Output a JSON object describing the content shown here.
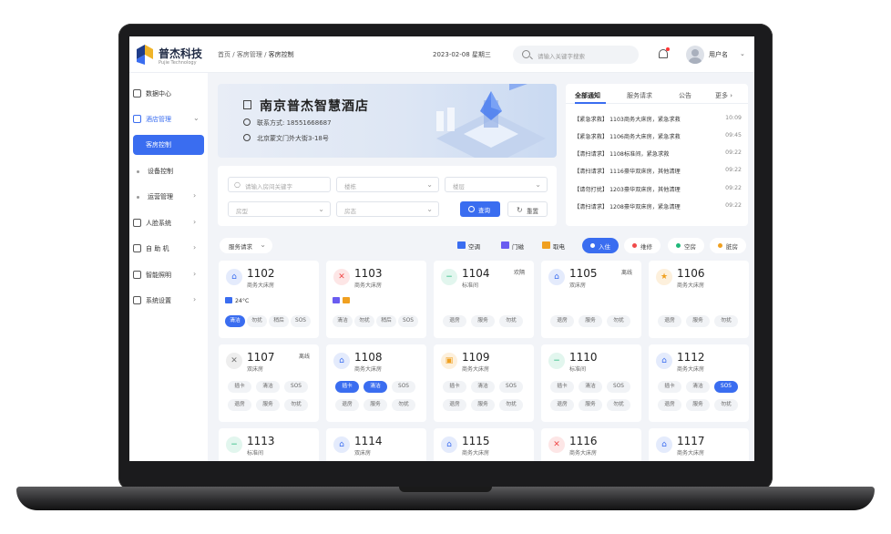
{
  "header": {
    "brand": "普杰科技",
    "brand_sub": "Pujie Technology",
    "breadcrumb": [
      "首页",
      "客房管理",
      "客房控制"
    ],
    "date": "2023-02-08 星期三",
    "search_placeholder": "请输入关键字搜索",
    "user_name": "用户名"
  },
  "sidebar": {
    "items": [
      {
        "label": "数据中心",
        "chevron": ""
      },
      {
        "label": "酒店管理",
        "chevron": "⌄"
      },
      {
        "label": "客房控制",
        "chevron": ""
      },
      {
        "label": "设备控制",
        "chevron": ""
      },
      {
        "label": "运营管理",
        "chevron": "›"
      },
      {
        "label": "人脸系统",
        "chevron": "›"
      },
      {
        "label": "自 助 机",
        "chevron": "›"
      },
      {
        "label": "智能照明",
        "chevron": "›"
      },
      {
        "label": "系统设置",
        "chevron": "›"
      }
    ]
  },
  "banner": {
    "hotel_name": "南京普杰智慧酒店",
    "contact": "联系方式: 18551668687",
    "address": "北京蒙文门外大街3-18号"
  },
  "notices": {
    "tabs": [
      "全部通知",
      "服务请求",
      "公告",
      "更多 ›"
    ],
    "items": [
      {
        "text": "【紧急求救】 1103商务大床房，紧急求救",
        "time": "10:09"
      },
      {
        "text": "【紧急求救】 1106商务大床房，紧急求救",
        "time": "09:45"
      },
      {
        "text": "【清扫请求】 1108标准间，紧急求救",
        "time": "09:22"
      },
      {
        "text": "【清扫请求】 1116豪华双床房，其他清理",
        "time": "09:22"
      },
      {
        "text": "【请勿打扰】 1203豪华双床房，其他清理",
        "time": "09:22"
      },
      {
        "text": "【清扫请求】 1208豪华双床房，紧急清理",
        "time": "09:22"
      }
    ]
  },
  "filters": {
    "keyword_placeholder": "请输入房间关键字",
    "building": "楼栋",
    "floor": "楼层",
    "room_type": "房型",
    "room_status": "房态",
    "query_label": "查询",
    "reset_label": "重置"
  },
  "legend": {
    "service_select": "服务请求",
    "devices": [
      {
        "label": "空调",
        "color": "#3a6df0"
      },
      {
        "label": "门磁",
        "color": "#6a5cf0"
      },
      {
        "label": "取电",
        "color": "#f0a020"
      }
    ],
    "statuses": [
      {
        "label": "入住",
        "color": "#ffffff",
        "selected": true
      },
      {
        "label": "维修",
        "color": "#f04a4a",
        "selected": false
      },
      {
        "label": "空房",
        "color": "#20b87a",
        "selected": false
      },
      {
        "label": "脏房",
        "color": "#f0a020",
        "selected": false
      }
    ]
  },
  "rooms": [
    {
      "number": "1102",
      "type": "商务大床房",
      "status": "",
      "icon": "⌂",
      "icon_bg": "#e4ebfc",
      "icon_color": "#3a6df0",
      "info": "24°C",
      "info_icons": [
        "#3a6df0"
      ],
      "tags": [
        {
          "label": "清洁",
          "on": true
        },
        {
          "label": "勿扰",
          "on": false
        },
        {
          "label": "稍后",
          "on": false
        },
        {
          "label": "SOS",
          "on": false
        }
      ]
    },
    {
      "number": "1103",
      "type": "商务大床房",
      "status": "",
      "icon": "✕",
      "icon_bg": "#fde6e6",
      "icon_color": "#f04a4a",
      "info": "",
      "info_icons": [
        "#6a5cf0",
        "#f0a020"
      ],
      "tags": [
        {
          "label": "清洁",
          "on": false
        },
        {
          "label": "勿扰",
          "on": false
        },
        {
          "label": "稍后",
          "on": false
        },
        {
          "label": "SOS",
          "on": false
        }
      ]
    },
    {
      "number": "1104",
      "type": "标准间",
      "status": "欢隔",
      "icon": "−",
      "icon_bg": "#e2f6ee",
      "icon_color": "#20b87a",
      "info": "",
      "info_icons": [],
      "tags": [
        {
          "label": "退房",
          "on": false
        },
        {
          "label": "服务",
          "on": false
        },
        {
          "label": "勿扰",
          "on": false
        }
      ]
    },
    {
      "number": "1105",
      "type": "双床房",
      "status": "离线",
      "icon": "⌂",
      "icon_bg": "#e4ebfc",
      "icon_color": "#3a6df0",
      "info": "",
      "info_icons": [],
      "tags": [
        {
          "label": "退房",
          "on": false
        },
        {
          "label": "服务",
          "on": false
        },
        {
          "label": "勿扰",
          "on": false
        }
      ]
    },
    {
      "number": "1106",
      "type": "商务大床房",
      "status": "",
      "icon": "★",
      "icon_bg": "#fdf0dc",
      "icon_color": "#f0a020",
      "info": "",
      "info_icons": [],
      "tags": [
        {
          "label": "退房",
          "on": false
        },
        {
          "label": "服务",
          "on": false
        },
        {
          "label": "勿扰",
          "on": false
        }
      ]
    },
    {
      "number": "1107",
      "type": "双床房",
      "status": "离线",
      "icon": "✕",
      "icon_bg": "#eeeeee",
      "icon_color": "#777777",
      "info": "",
      "info_icons": [],
      "tags": [
        {
          "label": "插卡",
          "on": false
        },
        {
          "label": "清洁",
          "on": false
        },
        {
          "label": "SOS",
          "on": false
        },
        {
          "label": "退房",
          "on": false
        },
        {
          "label": "服务",
          "on": false
        },
        {
          "label": "勿扰",
          "on": false
        }
      ]
    },
    {
      "number": "1108",
      "type": "商务大床房",
      "status": "",
      "icon": "⌂",
      "icon_bg": "#e4ebfc",
      "icon_color": "#3a6df0",
      "info": "",
      "info_icons": [],
      "tags": [
        {
          "label": "插卡",
          "on": true
        },
        {
          "label": "清洁",
          "on": true
        },
        {
          "label": "SOS",
          "on": false
        },
        {
          "label": "退房",
          "on": false
        },
        {
          "label": "服务",
          "on": false
        },
        {
          "label": "勿扰",
          "on": false
        }
      ]
    },
    {
      "number": "1109",
      "type": "商务大床房",
      "status": "",
      "icon": "▣",
      "icon_bg": "#fdf0dc",
      "icon_color": "#f0a020",
      "info": "",
      "info_icons": [],
      "tags": [
        {
          "label": "插卡",
          "on": false
        },
        {
          "label": "清洁",
          "on": false
        },
        {
          "label": "SOS",
          "on": false
        },
        {
          "label": "退房",
          "on": false
        },
        {
          "label": "服务",
          "on": false
        },
        {
          "label": "勿扰",
          "on": false
        }
      ]
    },
    {
      "number": "1110",
      "type": "标准间",
      "status": "",
      "icon": "−",
      "icon_bg": "#e2f6ee",
      "icon_color": "#20b87a",
      "info": "",
      "info_icons": [],
      "tags": [
        {
          "label": "插卡",
          "on": false
        },
        {
          "label": "清洁",
          "on": false
        },
        {
          "label": "SOS",
          "on": false
        },
        {
          "label": "退房",
          "on": false
        },
        {
          "label": "服务",
          "on": false
        },
        {
          "label": "勿扰",
          "on": false
        }
      ]
    },
    {
      "number": "1112",
      "type": "商务大床房",
      "status": "",
      "icon": "⌂",
      "icon_bg": "#e4ebfc",
      "icon_color": "#3a6df0",
      "info": "",
      "info_icons": [],
      "tags": [
        {
          "label": "插卡",
          "on": false
        },
        {
          "label": "清洁",
          "on": false
        },
        {
          "label": "SOS",
          "on": true
        },
        {
          "label": "退房",
          "on": false
        },
        {
          "label": "服务",
          "on": false
        },
        {
          "label": "勿扰",
          "on": false
        }
      ]
    },
    {
      "number": "1113",
      "type": "标准间",
      "status": "",
      "icon": "−",
      "icon_bg": "#e2f6ee",
      "icon_color": "#20b87a",
      "info": "",
      "info_icons": [],
      "tags": []
    },
    {
      "number": "1114",
      "type": "双床房",
      "status": "",
      "icon": "⌂",
      "icon_bg": "#e4ebfc",
      "icon_color": "#3a6df0",
      "info": "",
      "info_icons": [],
      "tags": []
    },
    {
      "number": "1115",
      "type": "商务大床房",
      "status": "",
      "icon": "⌂",
      "icon_bg": "#e4ebfc",
      "icon_color": "#3a6df0",
      "info": "",
      "info_icons": [],
      "tags": []
    },
    {
      "number": "1116",
      "type": "商务大床房",
      "status": "",
      "icon": "✕",
      "icon_bg": "#fde6e6",
      "icon_color": "#f04a4a",
      "info": "",
      "info_icons": [],
      "tags": []
    },
    {
      "number": "1117",
      "type": "商务大床房",
      "status": "",
      "icon": "⌂",
      "icon_bg": "#e4ebfc",
      "icon_color": "#3a6df0",
      "info": "",
      "info_icons": [],
      "tags": []
    }
  ]
}
